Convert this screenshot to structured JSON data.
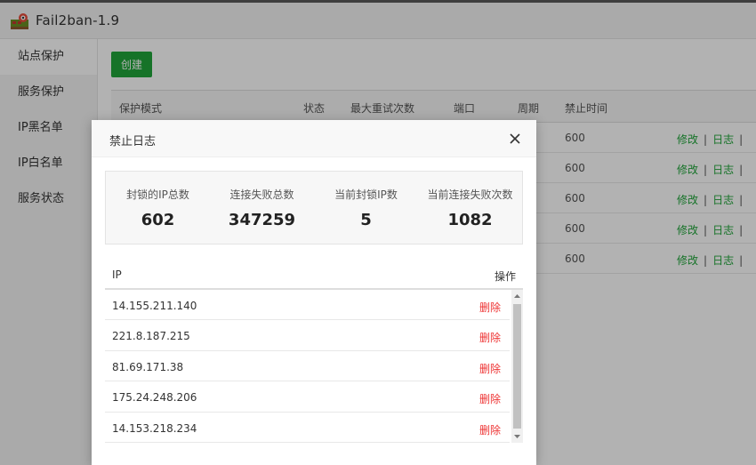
{
  "app": {
    "title": "Fail2ban-1.9"
  },
  "sidebar": {
    "items": [
      {
        "label": "站点保护"
      },
      {
        "label": "服务保护"
      },
      {
        "label": "IP黑名单"
      },
      {
        "label": "IP白名单"
      },
      {
        "label": "服务状态"
      }
    ]
  },
  "toolbar": {
    "create_label": "创建"
  },
  "bg_table": {
    "headers": [
      "保护模式",
      "状态",
      "最大重试次数",
      "端口",
      "周期",
      "禁止时间"
    ],
    "rows": [
      {
        "ban_time": "600",
        "edit": "修改",
        "log": "日志"
      },
      {
        "ban_time": "600",
        "edit": "修改",
        "log": "日志"
      },
      {
        "ban_time": "600",
        "edit": "修改",
        "log": "日志"
      },
      {
        "ban_time": "600",
        "edit": "修改",
        "log": "日志"
      },
      {
        "ban_time": "600",
        "edit": "修改",
        "log": "日志"
      }
    ],
    "separator": "|"
  },
  "modal": {
    "title": "禁止日志",
    "stats": [
      {
        "label": "封锁的IP总数",
        "value": "602"
      },
      {
        "label": "连接失败总数",
        "value": "347259"
      },
      {
        "label": "当前封锁IP数",
        "value": "5"
      },
      {
        "label": "当前连接失败次数",
        "value": "1082"
      }
    ],
    "table": {
      "col_ip": "IP",
      "col_action": "操作",
      "rows": [
        {
          "ip": "14.155.211.140",
          "action": "删除"
        },
        {
          "ip": "221.8.187.215",
          "action": "删除"
        },
        {
          "ip": "81.69.171.38",
          "action": "删除"
        },
        {
          "ip": "175.24.248.206",
          "action": "删除"
        },
        {
          "ip": "14.153.218.234",
          "action": "删除"
        }
      ]
    }
  },
  "colors": {
    "accent": "#20a53a",
    "danger": "#ee3333"
  }
}
